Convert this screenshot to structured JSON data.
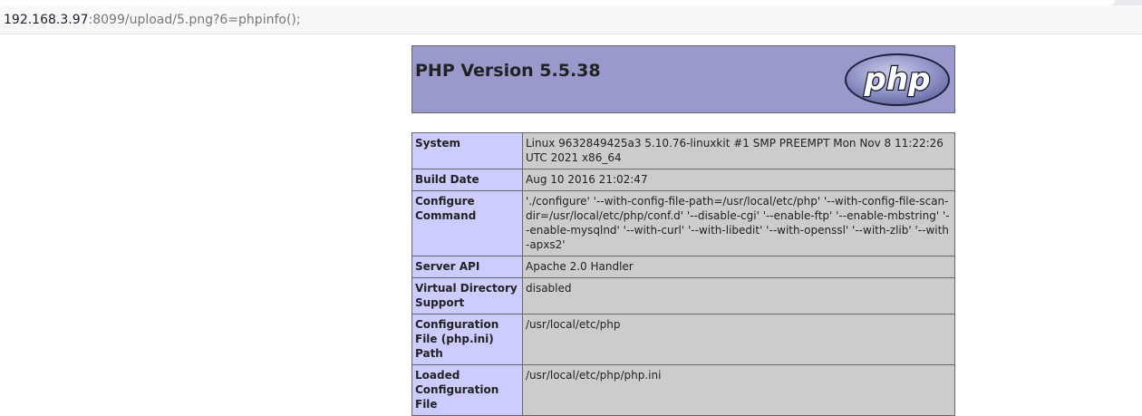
{
  "browser": {
    "url_host": "192.168.3.97",
    "url_rest": ":8099/upload/5.png?6=phpinfo();"
  },
  "phpinfo": {
    "title": "PHP Version 5.5.38",
    "logo_text": "php",
    "rows": [
      {
        "key": "System",
        "value": "Linux 9632849425a3 5.10.76-linuxkit #1 SMP PREEMPT Mon Nov 8 11:22:26 UTC 2021 x86_64"
      },
      {
        "key": "Build Date",
        "value": "Aug 10 2016 21:02:47"
      },
      {
        "key": "Configure Command",
        "value": "'./configure' '--with-config-file-path=/usr/local/etc/php' '--with-config-file-scan-dir=/usr/local/etc/php/conf.d' '--disable-cgi' '--enable-ftp' '--enable-mbstring' '--enable-mysqlnd' '--with-curl' '--with-libedit' '--with-openssl' '--with-zlib' '--with-apxs2'"
      },
      {
        "key": "Server API",
        "value": "Apache 2.0 Handler"
      },
      {
        "key": "Virtual Directory Support",
        "value": "disabled"
      },
      {
        "key": "Configuration File (php.ini) Path",
        "value": "/usr/local/etc/php"
      },
      {
        "key": "Loaded Configuration File",
        "value": "/usr/local/etc/php/php.ini"
      }
    ]
  }
}
